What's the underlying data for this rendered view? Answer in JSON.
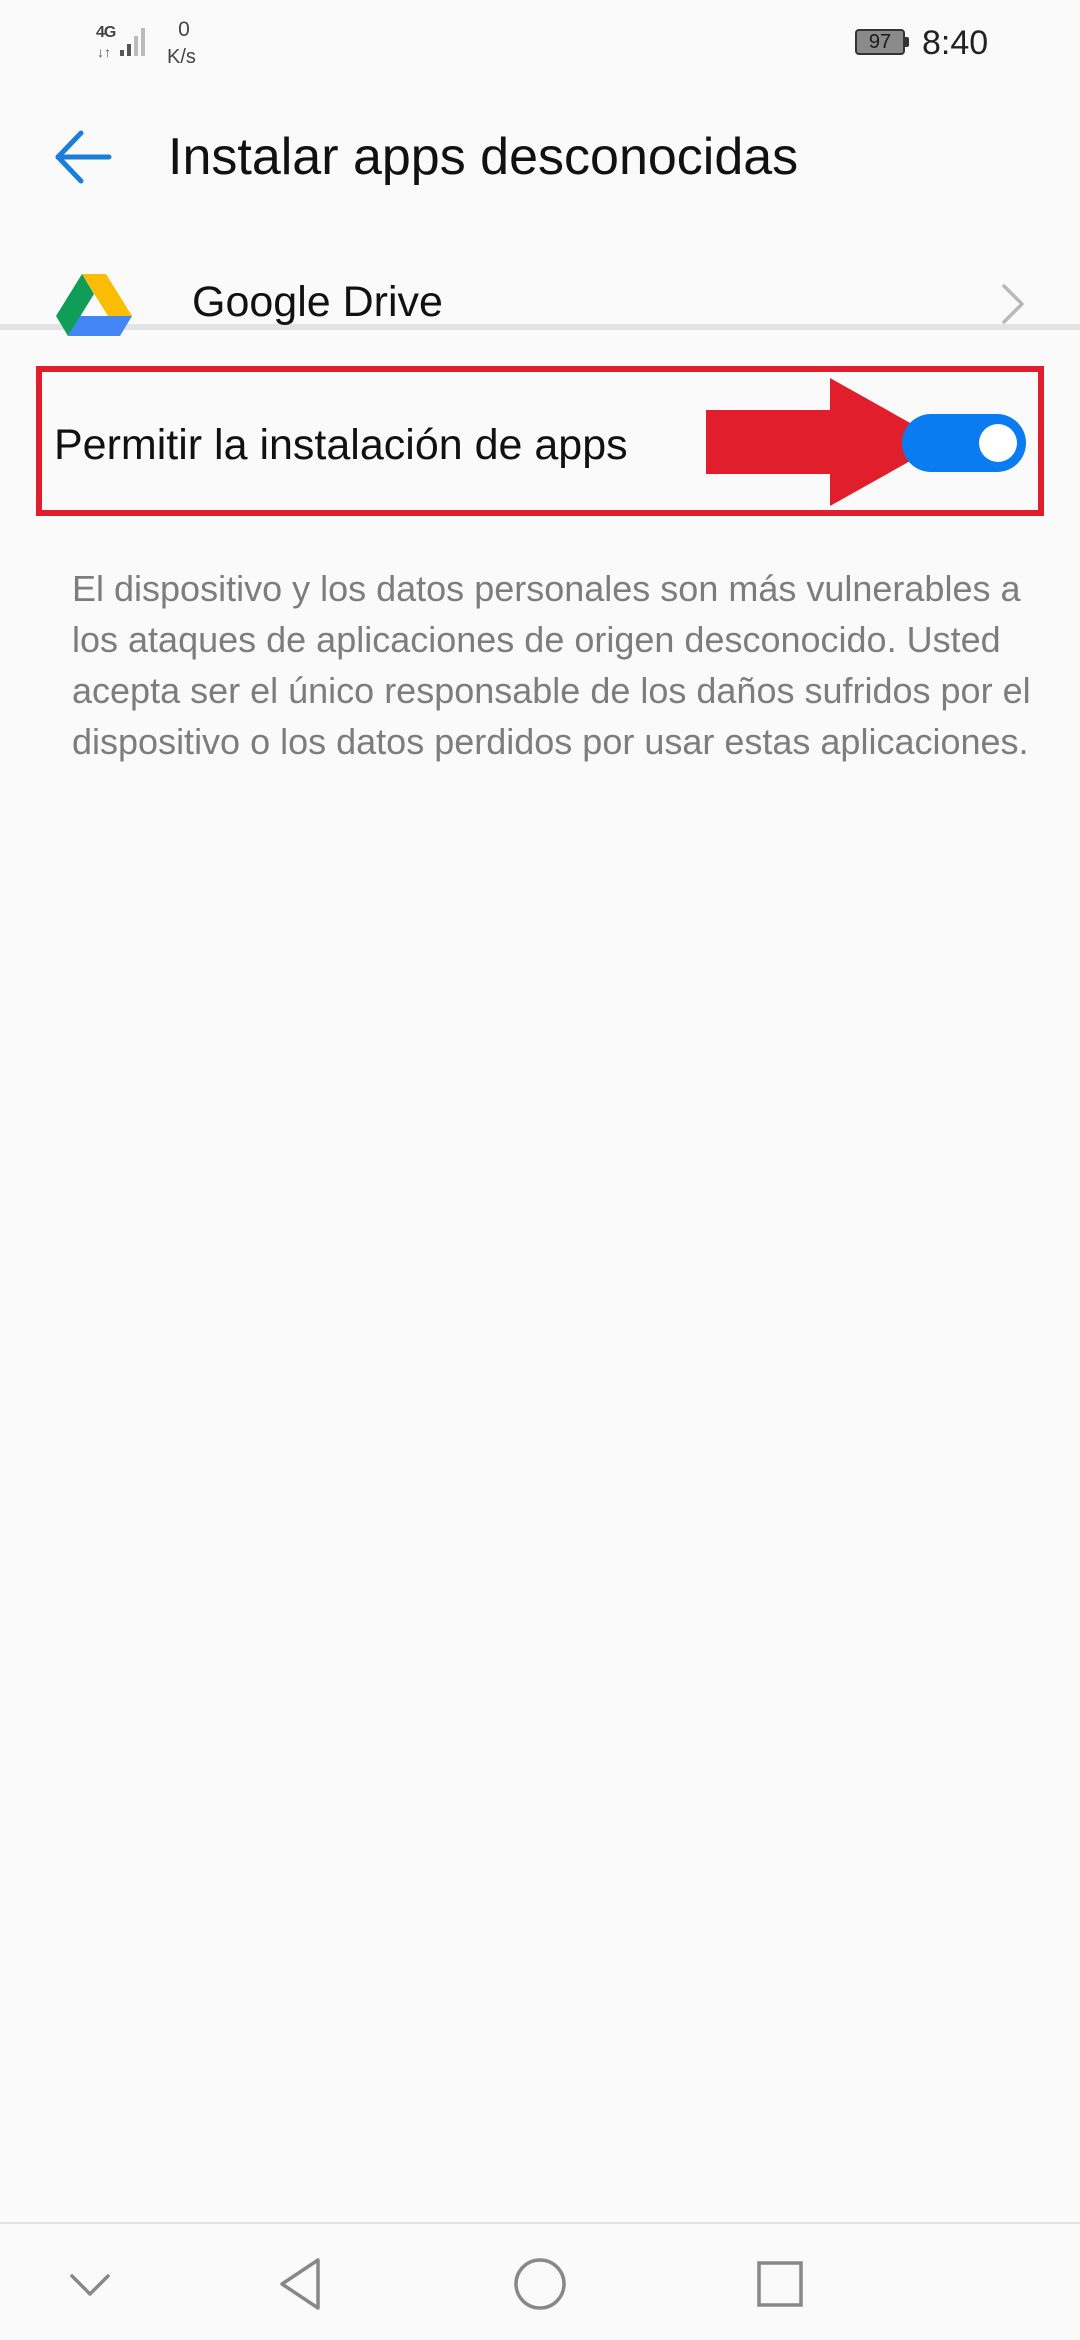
{
  "status_bar": {
    "network_type": "4G",
    "data_arrows": "↓↑",
    "speed_value": "0",
    "speed_unit": "K/s",
    "battery_level": "97",
    "time": "8:40"
  },
  "header": {
    "back_icon": "arrow-left-icon",
    "title": "Instalar apps desconocidas"
  },
  "app_row": {
    "icon": "google-drive-icon",
    "name": "Google Drive",
    "chevron_icon": "chevron-right-icon"
  },
  "permit_setting": {
    "label": "Permitir la instalación de apps",
    "enabled": true,
    "toggle_color": "#0a7bf0",
    "highlight_color": "#e01e2c",
    "arrow_icon": "red-arrow-icon"
  },
  "description": "El dispositivo y los datos personales son más vulnerables a los ataques de aplicaciones de origen desconocido. Usted acepta ser el único responsable de los daños sufridos por el dispositivo o los datos perdidos por usar estas aplicaciones.",
  "nav_bar": {
    "icons": [
      "chevron-down-icon",
      "back-triangle-icon",
      "home-circle-icon",
      "recents-square-icon"
    ]
  },
  "colors": {
    "accent": "#1a7fd8",
    "background": "#fafafa",
    "description_text": "#7d7d7d"
  }
}
